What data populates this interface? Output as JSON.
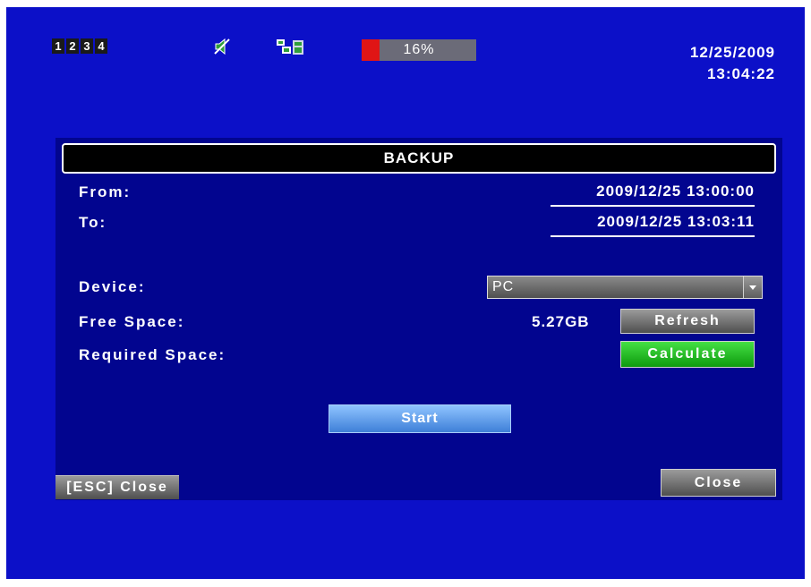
{
  "status_bar": {
    "channels": [
      "1",
      "2",
      "3",
      "4"
    ],
    "hdd_usage_percent": 16,
    "hdd_usage_label": "16%",
    "date": "12/25/2009",
    "time": "13:04:22"
  },
  "dialog": {
    "title": "BACKUP",
    "from_label": "From:",
    "from_value": "2009/12/25 13:00:00",
    "to_label": "To:",
    "to_value": "2009/12/25 13:03:11",
    "device_label": "Device:",
    "device_value": "PC",
    "free_space_label": "Free Space:",
    "free_space_value": "5.27GB",
    "refresh_label": "Refresh",
    "required_space_label": "Required Space:",
    "calculate_label": "Calculate",
    "start_label": "Start",
    "esc_hint": "[ESC] Close",
    "close_label": "Close"
  },
  "colors": {
    "screen_bg": "#0c10c8",
    "dialog_bg": "#02058f",
    "hdd_used": "#e01515",
    "calculate_green": "#2cc02c",
    "start_blue": "#5b9bef"
  },
  "icons": [
    "mute-speaker-icon",
    "network-film-icon",
    "dropdown-arrow-icon"
  ]
}
